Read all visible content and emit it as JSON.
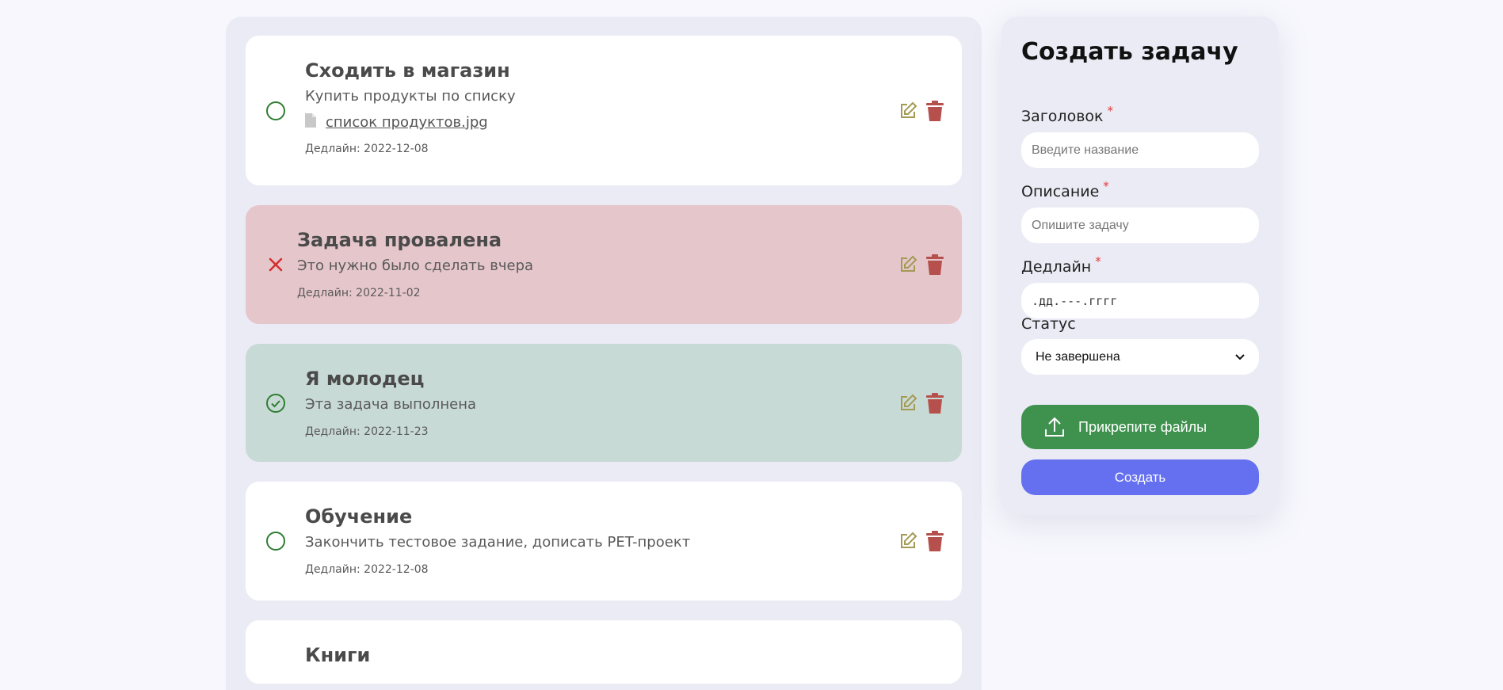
{
  "colors": {
    "page_bg": "#f7f7fd",
    "panel_bg": "#ebebf5",
    "failed_card": "#e5c6cb",
    "done_card": "#c8dad5",
    "status_green": "#2e7d32",
    "status_red": "#d32f2f",
    "edit_icon": "#a39a55",
    "delete_icon": "#b5504c",
    "attach_button": "#3f924e",
    "create_button": "#6470ef"
  },
  "tasks": [
    {
      "status": "open",
      "status_icon": "circle-outline-icon",
      "title": "Сходить в магазин",
      "description": "Купить продукты по списку",
      "file_icon": "file-icon",
      "file_name": "список продуктов.jpg",
      "deadline": "Дедлайн: 2022-12-08"
    },
    {
      "status": "failed",
      "status_icon": "x-mark-icon",
      "title": "Задача провалена",
      "description": "Это нужно было сделать вчера",
      "deadline": "Дедлайн: 2022-11-02"
    },
    {
      "status": "done",
      "status_icon": "check-circle-icon",
      "title": "Я молодец",
      "description": "Эта задача выполнена",
      "deadline": "Дедлайн: 2022-11-23"
    },
    {
      "status": "open",
      "status_icon": "circle-outline-icon",
      "title": "Обучение",
      "description": "Закончить тестовое задание, дописать PET-проект",
      "deadline": "Дедлайн: 2022-12-08"
    },
    {
      "title": "Книги"
    }
  ],
  "form": {
    "heading": "Создать задачу",
    "required_mark": "*",
    "title_label": "Заголовок",
    "title_placeholder": "Введите название",
    "title_value": "",
    "description_label": "Описание",
    "description_placeholder": "Опишите задачу",
    "description_value": "",
    "deadline_label": "Дедлайн",
    "deadline_value": ".дд.---.гггг",
    "status_label": "Статус",
    "status_value": "Не завершена",
    "attach_label": "Прикрепите файлы",
    "attach_icon": "upload-icon",
    "submit_label": "Создать"
  }
}
